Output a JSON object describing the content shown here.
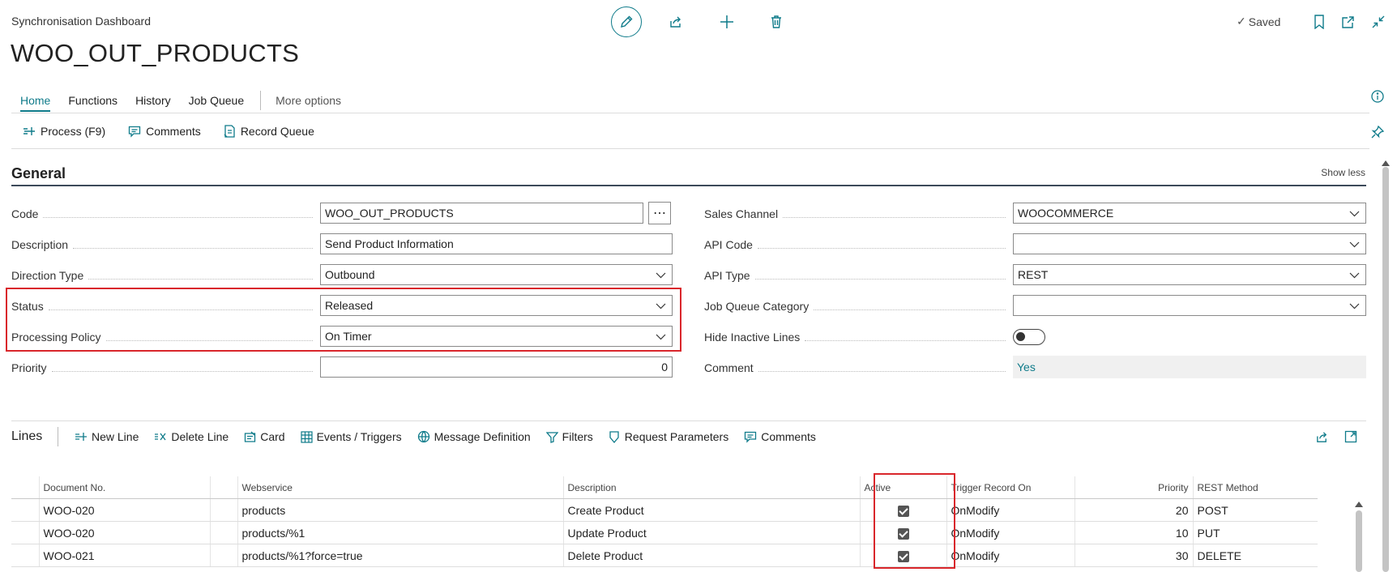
{
  "header": {
    "breadcrumb": "Synchronisation Dashboard",
    "title": "WOO_OUT_PRODUCTS",
    "saved_label": "Saved"
  },
  "tabs": [
    {
      "label": "Home",
      "active": true
    },
    {
      "label": "Functions"
    },
    {
      "label": "History"
    },
    {
      "label": "Job Queue"
    }
  ],
  "more_options": "More options",
  "actions": [
    {
      "label": "Process (F9)",
      "icon": "process-icon"
    },
    {
      "label": "Comments",
      "icon": "comment-icon"
    },
    {
      "label": "Record Queue",
      "icon": "record-queue-icon"
    }
  ],
  "general": {
    "title": "General",
    "show_less": "Show less",
    "left": {
      "code": {
        "label": "Code",
        "value": "WOO_OUT_PRODUCTS"
      },
      "description": {
        "label": "Description",
        "value": "Send Product Information"
      },
      "direction_type": {
        "label": "Direction Type",
        "value": "Outbound"
      },
      "status": {
        "label": "Status",
        "value": "Released"
      },
      "processing_policy": {
        "label": "Processing Policy",
        "value": "On Timer"
      },
      "priority": {
        "label": "Priority",
        "value": "0"
      }
    },
    "right": {
      "sales_channel": {
        "label": "Sales Channel",
        "value": "WOOCOMMERCE"
      },
      "api_code": {
        "label": "API Code",
        "value": ""
      },
      "api_type": {
        "label": "API Type",
        "value": "REST"
      },
      "job_queue_category": {
        "label": "Job Queue Category",
        "value": ""
      },
      "hide_inactive_lines": {
        "label": "Hide Inactive Lines",
        "value": false
      },
      "comment": {
        "label": "Comment",
        "value": "Yes"
      }
    }
  },
  "lines": {
    "title": "Lines",
    "actions": [
      {
        "label": "New Line",
        "icon": "new-line-icon"
      },
      {
        "label": "Delete Line",
        "icon": "delete-line-icon"
      },
      {
        "label": "Card",
        "icon": "card-icon"
      },
      {
        "label": "Events / Triggers",
        "icon": "grid-icon"
      },
      {
        "label": "Message Definition",
        "icon": "message-definition-icon"
      },
      {
        "label": "Filters",
        "icon": "filter-icon"
      },
      {
        "label": "Request Parameters",
        "icon": "request-parameters-icon"
      },
      {
        "label": "Comments",
        "icon": "comment-icon"
      }
    ],
    "columns": [
      "Document No.",
      "Webservice",
      "Description",
      "Active",
      "Trigger Record On",
      "Priority",
      "REST Method"
    ],
    "rows": [
      {
        "document_no": "WOO-020",
        "webservice": "products",
        "description": "Create Product",
        "active": true,
        "trigger": "OnModify",
        "priority": "20",
        "method": "POST"
      },
      {
        "document_no": "WOO-020",
        "webservice": "products/%1",
        "description": "Update Product",
        "active": true,
        "trigger": "OnModify",
        "priority": "10",
        "method": "PUT"
      },
      {
        "document_no": "WOO-021",
        "webservice": "products/%1?force=true",
        "description": "Delete Product",
        "active": true,
        "trigger": "OnModify",
        "priority": "30",
        "method": "DELETE"
      }
    ]
  },
  "colors": {
    "accent": "#0f7b8a",
    "highlight": "#d9262b"
  }
}
